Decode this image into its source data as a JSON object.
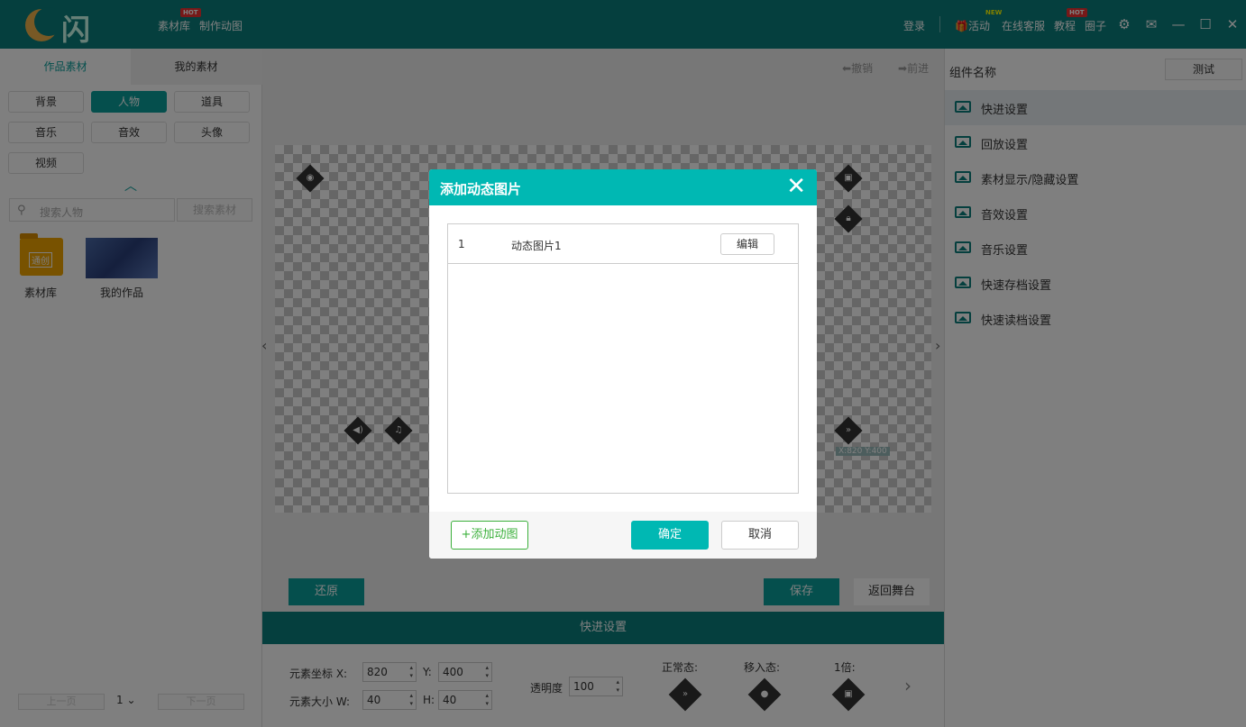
{
  "app": {
    "logo_text": "闪艺",
    "nav": [
      {
        "label": "素材库",
        "badge": "HOT"
      },
      {
        "label": "制作动图",
        "badge": ""
      }
    ],
    "login": "登录",
    "right_nav": [
      {
        "label": "活动",
        "badge": "NEW"
      },
      {
        "label": "在线客服",
        "badge": ""
      },
      {
        "label": "教程",
        "badge": "HOT"
      },
      {
        "label": "圈子",
        "badge": ""
      }
    ]
  },
  "left": {
    "tabs": [
      "作品素材",
      "我的素材"
    ],
    "active_tab": 0,
    "categories": [
      "背景",
      "人物",
      "道具",
      "音乐",
      "音效",
      "头像",
      "视频"
    ],
    "active_category": 1,
    "search_placeholder": "搜索人物",
    "search_button": "搜索素材",
    "items": [
      {
        "label": "素材库",
        "tag": "通创"
      },
      {
        "label": "我的作品"
      }
    ],
    "pager": {
      "prev": "上一页",
      "page": "1",
      "next": "下一页"
    }
  },
  "center": {
    "undo": "撤销",
    "redo": "前进",
    "restore": "还原",
    "save": "保存",
    "back": "返回舞台",
    "coord_label": "X:820 Y:400"
  },
  "right": {
    "title": "组件名称",
    "test_button": "测试",
    "items": [
      "快进设置",
      "回放设置",
      "素材显示/隐藏设置",
      "音效设置",
      "音乐设置",
      "快速存档设置",
      "快速读档设置"
    ],
    "active_item": 0
  },
  "bottom": {
    "section_title": "快进设置",
    "pos_label_x": "元素坐标 X:",
    "pos_x": "820",
    "pos_label_y": "Y:",
    "pos_y": "400",
    "size_label_w": "元素大小 W:",
    "size_w": "40",
    "size_label_h": "H:",
    "size_h": "40",
    "opacity_label": "透明度",
    "opacity": "100",
    "states": [
      "正常态:",
      "移入态:",
      "1倍:"
    ]
  },
  "modal": {
    "title": "添加动态图片",
    "rows": [
      {
        "index": "1",
        "name": "动态图片1",
        "action": "编辑"
      }
    ],
    "add_button": "+添加动图",
    "ok_button": "确定",
    "cancel_button": "取消"
  },
  "colors": {
    "topbar": "#0a7f7d",
    "accent": "#00b8b3",
    "teal_button": "#0a9f9b"
  }
}
